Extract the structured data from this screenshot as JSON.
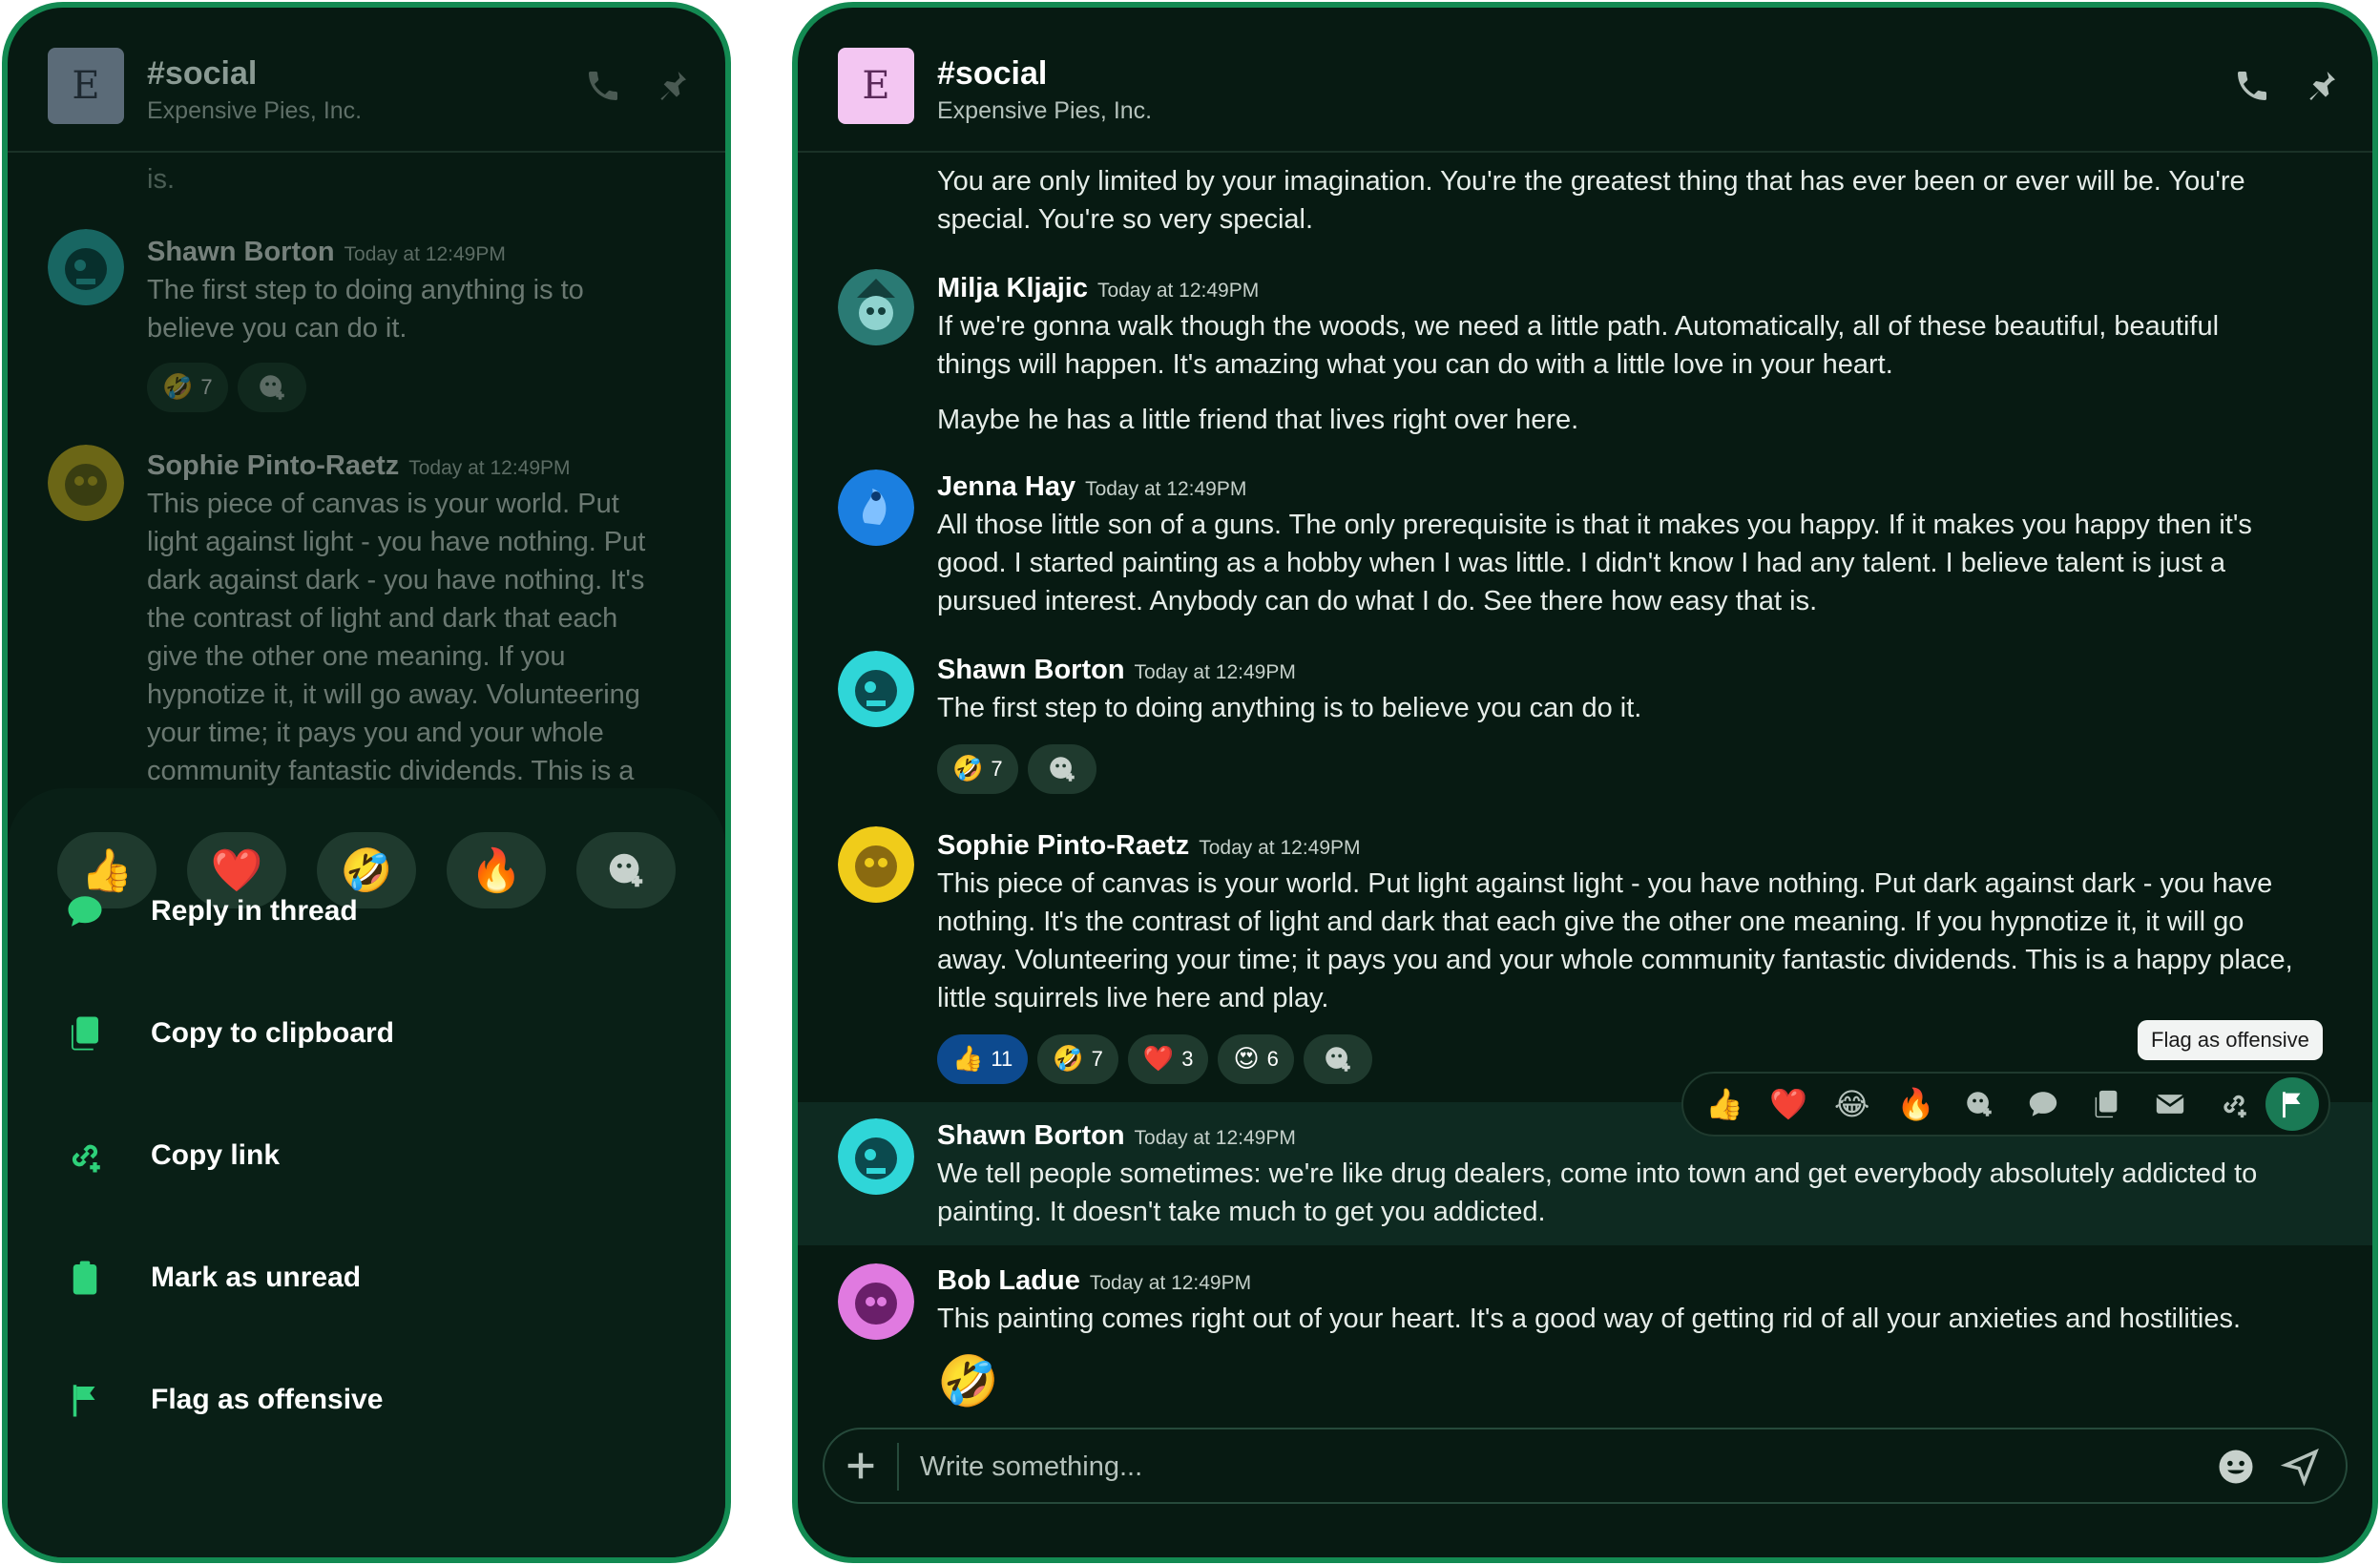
{
  "channel": {
    "name": "#social",
    "workspace": "Expensive Pies, Inc.",
    "badge_letter": "E"
  },
  "colors": {
    "accent": "#138a52",
    "bg": "#071a12",
    "badge_mobile": "#5b6b78",
    "badge_desktop": "#f3c6f2"
  },
  "mobile": {
    "clipped_top_text": "is.",
    "messages": [
      {
        "author": "Shawn Borton",
        "time": "Today at 12:49PM",
        "lines": [
          "The first step to doing anything is to",
          "believe you can do it."
        ],
        "reactions": [
          {
            "emoji": "🤣",
            "count": "7"
          }
        ]
      },
      {
        "author": "Sophie Pinto-Raetz",
        "time": "Today at 12:49PM",
        "lines": [
          "This piece of canvas is your world. Put",
          "light against light - you have nothing. Put",
          "dark against dark - you have nothing. It's",
          "the contrast of light and dark that each",
          "give the other one meaning. If you",
          "hypnotize it, it will go away. Volunteering",
          "your time; it pays you and your whole",
          "community fantastic dividends. This is a"
        ]
      }
    ],
    "quick_reactions": [
      "👍",
      "❤️",
      "🤣",
      "🔥"
    ],
    "actions": [
      {
        "label": "Reply in thread",
        "icon": "chat-bubble-icon"
      },
      {
        "label": "Copy to clipboard",
        "icon": "clipboard-copy-icon"
      },
      {
        "label": "Copy link",
        "icon": "link-add-icon"
      },
      {
        "label": "Mark as unread",
        "icon": "clipboard-icon"
      },
      {
        "label": "Flag as offensive",
        "icon": "flag-icon"
      }
    ]
  },
  "desktop": {
    "clipped_top_lines": [
      "You are only limited by your imagination. You're the greatest thing that has ever been or ever will be. You're",
      "special. You're so very special."
    ],
    "messages": [
      {
        "author": "Milja Kljajic",
        "time": "Today at 12:49PM",
        "lines": [
          "If we're gonna walk though the woods, we need a little path. Automatically, all of these beautiful, beautiful",
          "things will happen. It's amazing what you can do with a little love in your heart."
        ],
        "extra": "Maybe he has a little friend that lives right over here."
      },
      {
        "author": "Jenna Hay",
        "time": "Today at 12:49PM",
        "lines": [
          "All those little son of a guns. The only prerequisite is that it makes you happy. If it makes you happy then it's",
          "good. I started painting as a hobby when I was little. I didn't know I had any talent. I believe talent is just a",
          "pursued interest. Anybody can do what I do. See there how easy that is."
        ]
      },
      {
        "author": "Shawn Borton",
        "time": "Today at 12:49PM",
        "lines": [
          "The first step to doing anything is to believe you can do it."
        ],
        "reactions": [
          {
            "emoji": "🤣",
            "count": "7"
          }
        ]
      },
      {
        "author": "Sophie Pinto-Raetz",
        "time": "Today at 12:49PM",
        "lines": [
          "This piece of canvas is your world. Put light against light - you have nothing. Put dark against dark - you have",
          "nothing. It's the contrast of light and dark that each give the other one meaning. If you hypnotize it, it will go",
          "away. Volunteering your time; it pays you and your whole community fantastic dividends. This is a happy place,",
          "little squirrels live here and play."
        ],
        "reactions": [
          {
            "emoji": "👍",
            "count": "11"
          },
          {
            "emoji": "🤣",
            "count": "7"
          },
          {
            "emoji": "❤️",
            "count": "3"
          },
          {
            "emoji": "😍",
            "count": "6"
          }
        ]
      },
      {
        "author": "Shawn Borton",
        "time": "Today at 12:49PM",
        "lines": [
          "We tell people sometimes: we're like drug dealers, come into town and get everybody absolutely addicted to",
          "painting. It doesn't take much to get you addicted."
        ]
      },
      {
        "author": "Bob Ladue",
        "time": "Today at 12:49PM",
        "lines": [
          "This painting comes right out of your heart. It's a good way of getting rid of all your anxieties and hostilities."
        ],
        "big_emoji": "🤣"
      }
    ],
    "toolbar": [
      "👍",
      "❤️",
      "😂",
      "🔥"
    ],
    "tooltip": "Flag as offensive",
    "composer_placeholder": "Write something..."
  }
}
